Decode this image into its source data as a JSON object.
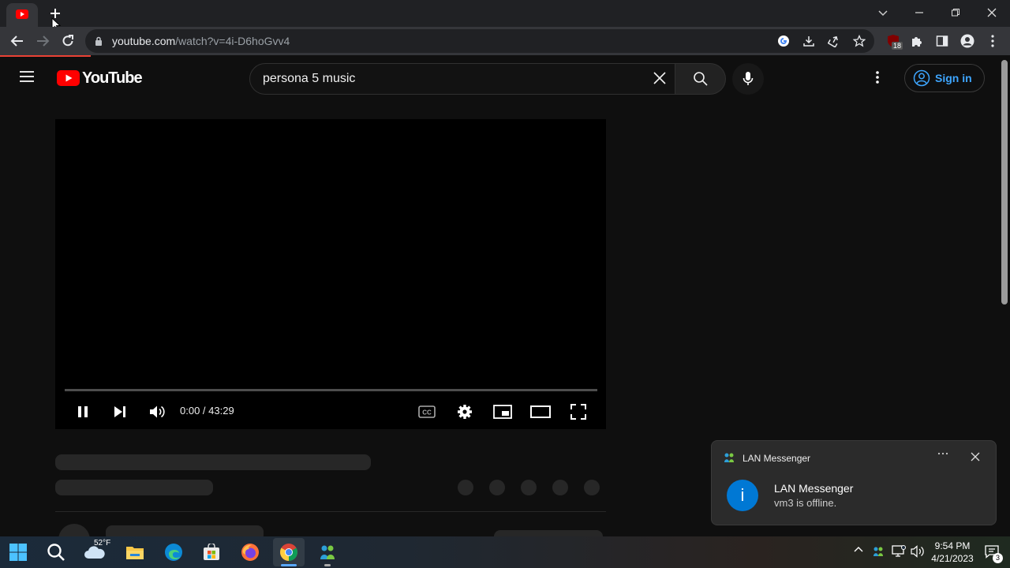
{
  "browser": {
    "url_host": "youtube.com",
    "url_path": "/watch?v=4i-D6hoGvv4",
    "extension_badge": "18"
  },
  "youtube": {
    "logo_text": "YouTube",
    "search_value": "persona 5 music",
    "sign_in_label": "Sign in"
  },
  "player": {
    "time_display": "0:00 / 43:29",
    "progress": 0
  },
  "notification": {
    "app_name": "LAN Messenger",
    "title": "LAN Messenger",
    "body": "vm3 is offline."
  },
  "taskbar": {
    "weather": "52°F",
    "time": "9:54 PM",
    "date": "4/21/2023",
    "notification_count": "3"
  },
  "colors": {
    "youtube_red": "#ff0000",
    "accent_blue": "#3ea6ff",
    "chrome_frame": "#202124"
  }
}
